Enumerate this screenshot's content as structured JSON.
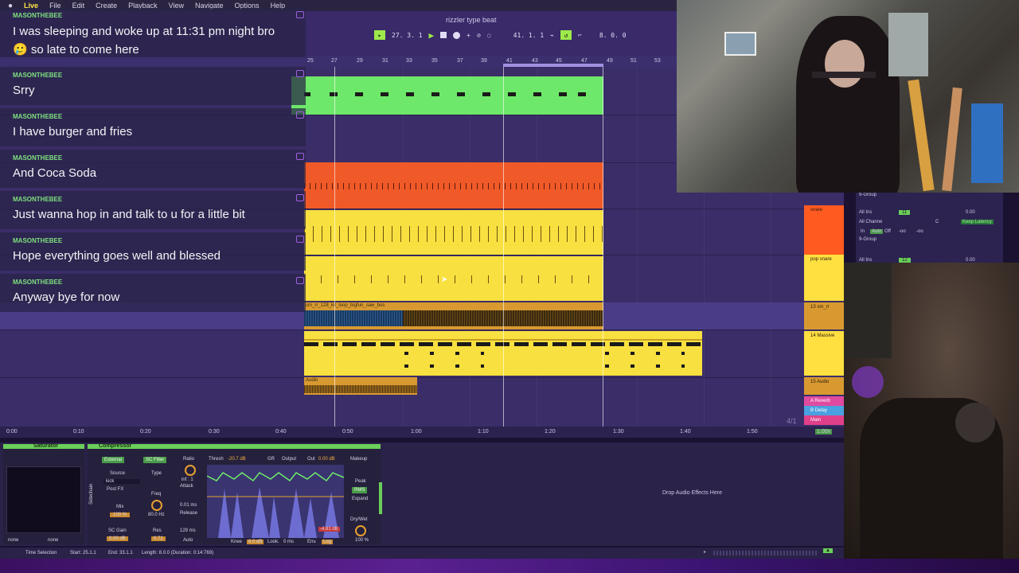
{
  "menubar": {
    "items": [
      "Live",
      "File",
      "Edit",
      "Create",
      "Playback",
      "View",
      "Navigate",
      "Options",
      "Help"
    ]
  },
  "transport": {
    "project_title": "rizzler type beat",
    "arrangement_position": "27.  3.  1",
    "loop_start": "41.  1.  1",
    "loop_length": "8.  0.  0"
  },
  "ruler": {
    "bars": [
      "25",
      "27",
      "29",
      "31",
      "33",
      "35",
      "37",
      "39",
      "41",
      "43",
      "45",
      "47",
      "49",
      "51",
      "53"
    ]
  },
  "timeline": {
    "times": [
      "0:00",
      "0:10",
      "0:20",
      "0:30",
      "0:40",
      "0:50",
      "1:00",
      "1:10",
      "1:20",
      "1:30",
      "1:40",
      "1:50"
    ]
  },
  "tracks": [
    {
      "name": "snare",
      "color": "#ff5a20"
    },
    {
      "name": "pop snare",
      "color": "#ffe040"
    },
    {
      "name": "13 sm_rr",
      "color": "#d89a30"
    },
    {
      "name": "14 Massive",
      "color": "#ffe040"
    },
    {
      "name": "15 Audio",
      "color": "#d89a30"
    },
    {
      "name": "A Reverb",
      "color": "#e04aa0"
    },
    {
      "name": "B Delay",
      "color": "#4aa0e0"
    },
    {
      "name": "Main",
      "color": "#e0408a"
    }
  ],
  "clips": {
    "audio_clip_name": "sm_rr_128_kit_loop_bigfun_saw_bos",
    "audio2_name": "Audio"
  },
  "mixer": {
    "group_label": "9-Group",
    "input": "All Ins",
    "channel": "All Channe",
    "monitor_in": "In",
    "monitor_auto": "Auto",
    "monitor_off": "Off",
    "track11": "11",
    "track12": "12",
    "vol1": "0.00",
    "vol2": "0.00",
    "keep_latency": "Keep Latency",
    "pan": "C",
    "neg_inf": "-oo"
  },
  "devices": {
    "saturator_title": "Saturator",
    "saturator_none1": "none",
    "saturator_none2": "none",
    "comp_title": "Compressor",
    "external": "External",
    "sc_filter": "SC Filter",
    "source": "Source",
    "source_val": "kick",
    "post_fx": "Post FX",
    "type": "Type",
    "freq": "Freq",
    "freq_val": "80.0 Hz",
    "mix": "Mix",
    "mix_val": "100 %",
    "sc_gain": "SC Gain",
    "sc_gain_val": "0.00 dB",
    "res": "Res",
    "res_val": "0.71",
    "sidechain": "Sidechain",
    "ratio": "Ratio",
    "ratio_val": "inf : 1",
    "attack": "Attack",
    "attack_val": "0.01 ms",
    "release": "Release",
    "release_val": "129 ms",
    "auto": "Auto",
    "thresh": "Thresh",
    "thresh_val": "-20.7 dB",
    "gr": "GR",
    "output": "Output",
    "out": "Out",
    "out_val": "0.00 dB",
    "makeup": "Makeup",
    "peak": "Peak",
    "rms": "RMS",
    "expand": "Expand",
    "gr_readout": "-4.81 dB",
    "knee": "Knee",
    "knee_val": "6.0 dB",
    "look": "Look.",
    "look_val": "0 ms",
    "env": "Env.",
    "log": "Log",
    "drywet": "Dry/Wet",
    "drywet_val": "100 %",
    "drop_hint": "Drop Audio Effects Here"
  },
  "status": {
    "time_selection": "Time Selection",
    "start": "Start: 25.1.1",
    "end": "End: 33.1.1",
    "length": "Length: 8.0.0 (Duration: 0:14:769)",
    "meter": "4/1",
    "zoom": "1.00x"
  },
  "chat": [
    {
      "user": "MASONTHEBEE",
      "text": "I was sleeping and woke up at 11:31 pm night bro"
    },
    {
      "user": "",
      "text": "🥲 so late to come here"
    },
    {
      "user": "MASONTHEBEE",
      "text": "Srry"
    },
    {
      "user": "MASONTHEBEE",
      "text": "I have burger and fries"
    },
    {
      "user": "MASONTHEBEE",
      "text": "And Coca Soda"
    },
    {
      "user": "MASONTHEBEE",
      "text": "Just wanna hop in and talk to u for a little bit"
    },
    {
      "user": "MASONTHEBEE",
      "text": "Hope everything goes well and blessed"
    },
    {
      "user": "MASONTHEBEE",
      "text": "Anyway bye for now"
    }
  ]
}
